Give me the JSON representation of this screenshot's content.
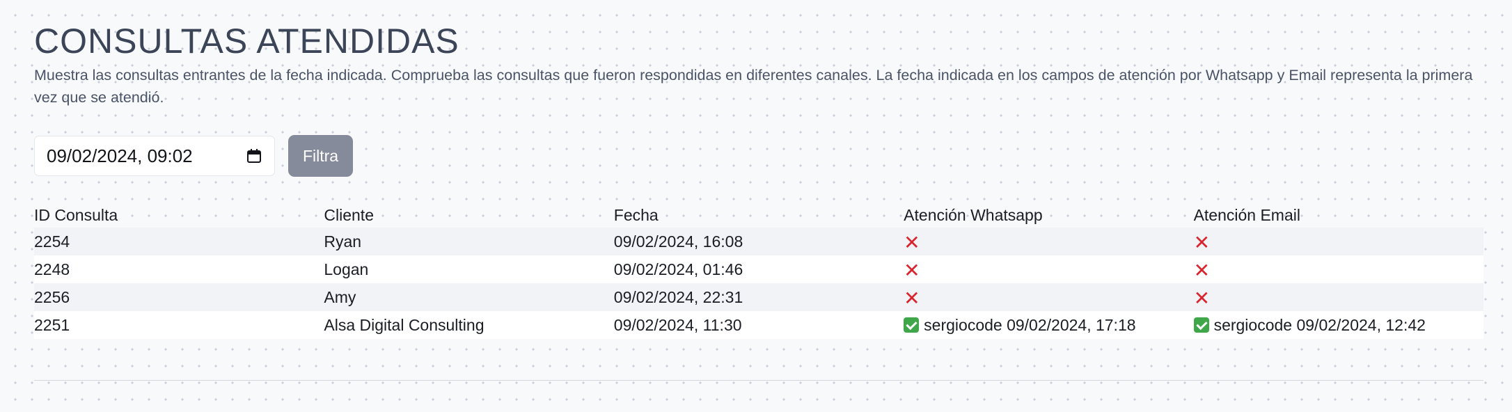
{
  "header": {
    "title": "CONSULTAS ATENDIDAS",
    "description": "Muestra las consultas entrantes de la fecha indicada. Comprueba las consultas que fueron respondidas en diferentes canales. La fecha indicada en los campos de atención por Whatsapp y Email representa la primera vez que se atendió."
  },
  "filter": {
    "date_value": "09/02/2024, 09:02",
    "date_icon": "calendar-icon",
    "button_label": "Filtra",
    "button_color": "#868b9b"
  },
  "table": {
    "columns": [
      "ID Consulta",
      "Cliente",
      "Fecha",
      "Atención Whatsapp",
      "Atención Email"
    ],
    "rows": [
      {
        "id": "2254",
        "cliente": "Ryan",
        "fecha": "09/02/2024, 16:08",
        "whatsapp": {
          "status": "no",
          "icon": "cross-icon",
          "text": ""
        },
        "email": {
          "status": "no",
          "icon": "cross-icon",
          "text": ""
        }
      },
      {
        "id": "2248",
        "cliente": "Logan",
        "fecha": "09/02/2024, 01:46",
        "whatsapp": {
          "status": "no",
          "icon": "cross-icon",
          "text": ""
        },
        "email": {
          "status": "no",
          "icon": "cross-icon",
          "text": ""
        }
      },
      {
        "id": "2256",
        "cliente": "Amy",
        "fecha": "09/02/2024, 22:31",
        "whatsapp": {
          "status": "no",
          "icon": "cross-icon",
          "text": ""
        },
        "email": {
          "status": "no",
          "icon": "cross-icon",
          "text": ""
        }
      },
      {
        "id": "2251",
        "cliente": "Alsa Digital Consulting",
        "fecha": "09/02/2024, 11:30",
        "whatsapp": {
          "status": "yes",
          "icon": "check-icon",
          "text": "sergiocode 09/02/2024, 17:18"
        },
        "email": {
          "status": "yes",
          "icon": "check-icon",
          "text": "sergiocode 09/02/2024, 12:42"
        }
      }
    ]
  },
  "colors": {
    "cross": "#d9252e",
    "check": "#3fa64a",
    "title": "#3c4558"
  }
}
